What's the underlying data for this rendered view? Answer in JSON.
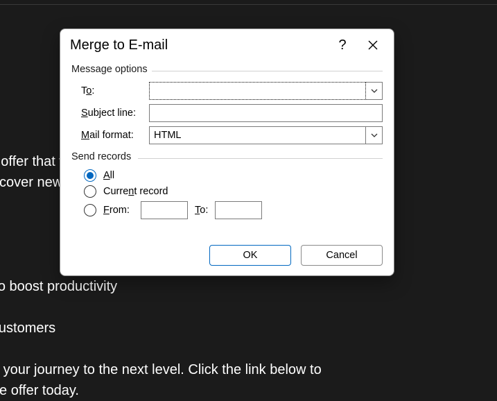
{
  "background_text": "to announce an exclusive offer that will help you reach your goals. Whether\nto enhance your skills, discover new products, or make life easier, we have\nsial just for you.\n\nuct/service name here]\n\n-edge features designed to boost productivity\nched customer support\ndiscounts for our valued customers\n\non this opportunity to take your journey to the next level. Click the link below to\nadvantage of this exclusive offer today.",
  "dialog": {
    "title": "Merge to E-mail",
    "help_glyph": "?",
    "sections": {
      "message_options": {
        "legend": "Message options",
        "to_label_pre": "T",
        "to_label_u": "o",
        "to_label_post": ":",
        "to_value": "",
        "subject_label_u": "S",
        "subject_label_post": "ubject line:",
        "subject_value": "",
        "mail_label_u": "M",
        "mail_label_post": "ail format:",
        "mail_value": "HTML"
      },
      "send_records": {
        "legend": "Send records",
        "all_u": "A",
        "all_post": "ll",
        "current_pre": "Curre",
        "current_u": "n",
        "current_post": "t record",
        "from_u": "F",
        "from_post": "rom:",
        "from_value": "",
        "to_u": "T",
        "to_post": "o:",
        "to_value": ""
      }
    },
    "buttons": {
      "ok": "OK",
      "cancel": "Cancel"
    }
  }
}
